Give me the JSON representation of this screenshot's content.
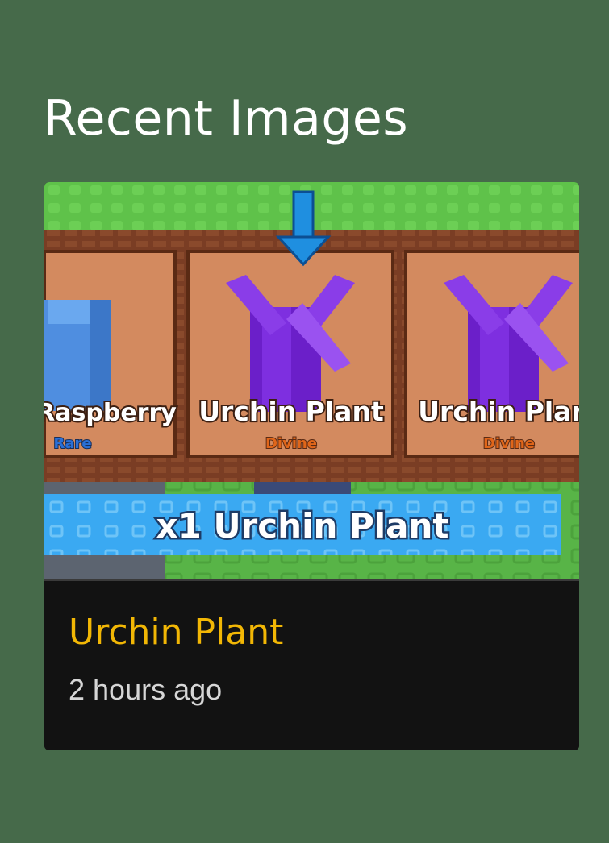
{
  "section": {
    "title": "Recent Images"
  },
  "recent_images": [
    {
      "name": "Urchin Plant",
      "time": "2 hours ago",
      "screenshot": {
        "slots": [
          {
            "label": "Raspberry",
            "rarity": "Rare",
            "rarity_color": "#2a6fd6"
          },
          {
            "label": "Urchin Plant",
            "rarity": "Divine",
            "rarity_color": "#e0661a"
          },
          {
            "label": "Urchin Plant",
            "rarity": "Divine",
            "rarity_color": "#e0661a"
          }
        ],
        "banner": "x1 Urchin Plant"
      }
    }
  ],
  "colors": {
    "page_bg": "#466a4a",
    "accent": "#f2b705",
    "card_bg": "#121212",
    "banner_blue": "#3aa9f2"
  }
}
